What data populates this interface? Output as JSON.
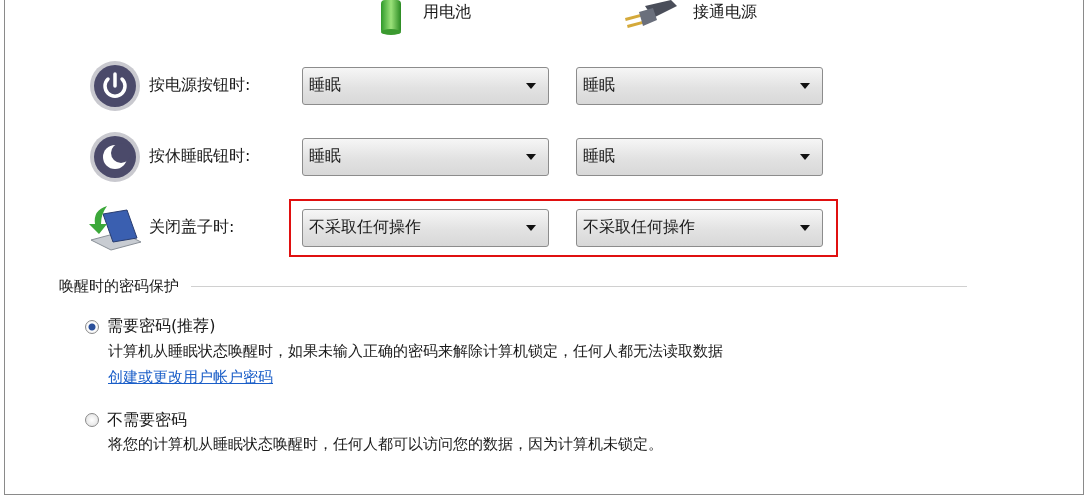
{
  "columns": [
    {
      "kind": "battery",
      "label": "用电池"
    },
    {
      "kind": "plug",
      "label": "接通电源"
    }
  ],
  "settings": [
    {
      "kind": "power",
      "label": "按电源按钮时:",
      "values": [
        "睡眠",
        "睡眠"
      ],
      "highlighted": false
    },
    {
      "kind": "sleep",
      "label": "按休睡眠钮时:",
      "values": [
        "睡眠",
        "睡眠"
      ],
      "highlighted": false
    },
    {
      "kind": "lid",
      "label": "关闭盖子时:",
      "values": [
        "不采取任何操作",
        "不采取任何操作"
      ],
      "highlighted": true
    }
  ],
  "password_section": {
    "title": "唤醒时的密码保护",
    "options": [
      {
        "label": "需要密码(推荐)",
        "selected": true,
        "description": "计算机从睡眠状态唤醒时，如果未输入正确的密码来解除计算机锁定，任何人都无法读取数据",
        "link": "创建或更改用户帐户密码"
      },
      {
        "label": "不需要密码",
        "selected": false,
        "description": "将您的计算机从睡眠状态唤醒时，任何人都可以访问您的数据，因为计算机未锁定。"
      }
    ]
  }
}
